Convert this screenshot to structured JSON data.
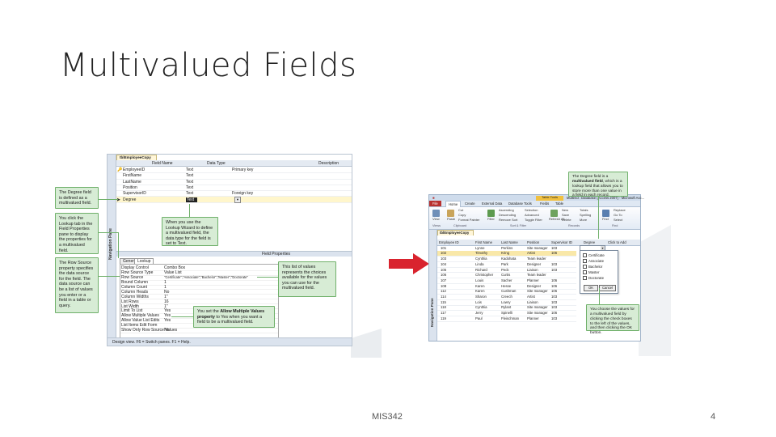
{
  "slide": {
    "title": "Multivalued Fields",
    "footer_course": "MIS342",
    "page_number": "4"
  },
  "left_screenshot": {
    "table_tab": "tblEmployeeCopy",
    "nav_pane_label": "Navigation Pane",
    "columns": {
      "field_name": "Field Name",
      "data_type": "Data Type",
      "description": "Description"
    },
    "fields": [
      {
        "name": "EmployeeID",
        "type": "Text",
        "description": "Primary key"
      },
      {
        "name": "FirstName",
        "type": "Text",
        "description": ""
      },
      {
        "name": "LastName",
        "type": "Text",
        "description": ""
      },
      {
        "name": "Position",
        "type": "Text",
        "description": ""
      },
      {
        "name": "SupervisorID",
        "type": "Text",
        "description": "Foreign key"
      },
      {
        "name": "Degree",
        "type": "Text",
        "description": ""
      }
    ],
    "field_properties_label": "Field Properties",
    "property_tabs": [
      "General",
      "Lookup"
    ],
    "lookup_properties": [
      {
        "name": "Display Control",
        "value": "Combo Box"
      },
      {
        "name": "Row Source Type",
        "value": "Value List"
      },
      {
        "name": "Row Source",
        "value": "\"Certificate\";\"Associate\";\"Bachelor\";\"Master\";\"Doctorate\""
      },
      {
        "name": "Bound Column",
        "value": "1"
      },
      {
        "name": "Column Count",
        "value": "1"
      },
      {
        "name": "Column Heads",
        "value": "No"
      },
      {
        "name": "Column Widths",
        "value": "1\""
      },
      {
        "name": "List Rows",
        "value": "16"
      },
      {
        "name": "List Width",
        "value": "1\""
      },
      {
        "name": "Limit To List",
        "value": "Yes"
      },
      {
        "name": "Allow Multiple Values",
        "value": "Yes"
      },
      {
        "name": "Allow Value List Edits",
        "value": "Yes"
      },
      {
        "name": "List Items Edit Form",
        "value": ""
      },
      {
        "name": "Show Only Row Source Values",
        "value": "No"
      }
    ],
    "status_bar": "Design view. F6 = Switch panes. F1 = Help."
  },
  "left_callouts": {
    "degree_field": "The Degree field is defined as a multivalued field.",
    "lookup_tab": "You click the Lookup tab in the Field Properties pane to display the properties for a multivalued field.",
    "row_source": "The Row Source property specifies the data source for the field. The data source can be a list of values you enter or a field in a table or query.",
    "lookup_wizard": "When you use the Lookup Wizard to define a multivalued field, the data type for the field is set to Text.",
    "value_list": "This list of values represents the choices available for the values you can use for the multivalued field.",
    "allow_multiple_pre": "You set the ",
    "allow_multiple_bold": "Allow Multiple Values property",
    "allow_multiple_post": " to Yes when you want a field to be a multivalued field."
  },
  "right_screenshot": {
    "window_title": "Mullend : Database (Access 2007) - Microsoft Acc...",
    "context_tab": "Table Tools",
    "ribbon_tabs": [
      "File",
      "Home",
      "Create",
      "External Data",
      "Database Tools",
      "Fields",
      "Table"
    ],
    "ribbon_items": {
      "view": "View",
      "paste": "Paste",
      "cut": "Cut",
      "copy": "Copy",
      "format_painter": "Format Painter",
      "filter": "Filter",
      "ascending": "Ascending",
      "descending": "Descending",
      "remove_sort": "Remove Sort",
      "selection": "Selection",
      "advanced": "Advanced",
      "toggle_filter": "Toggle Filter",
      "refresh": "Refresh All",
      "new": "New",
      "save": "Save",
      "delete": "Delete",
      "totals": "Totals",
      "spelling": "Spelling",
      "more": "More",
      "find": "Find",
      "replace": "Replace",
      "goto": "Go To",
      "select": "Select"
    },
    "ribbon_groups": [
      "Views",
      "Clipboard",
      "Sort & Filter",
      "Records",
      "Find"
    ],
    "nav_pane_label": "Navigation Pane",
    "table_tab": "tblEmployeeCopy",
    "columns": [
      "Employee ID",
      "First Name",
      "Last Name",
      "Position",
      "Supervisor ID",
      "Degree",
      "Click to Add"
    ],
    "rows": [
      [
        "101",
        "Lynne",
        "Perkins",
        "Site manager",
        "103"
      ],
      [
        "102",
        "Timothy",
        "Kring",
        "Artist",
        "106"
      ],
      [
        "103",
        "Cynthia",
        "Kadohata",
        "Team leader",
        ""
      ],
      [
        "104",
        "Linda",
        "Park",
        "Designer",
        "103"
      ],
      [
        "105",
        "Richard",
        "Peck",
        "Liaison",
        "103"
      ],
      [
        "106",
        "Christopher",
        "Curtis",
        "Team leader",
        ""
      ],
      [
        "107",
        "Louis",
        "Sacher",
        "Planner",
        "106"
      ],
      [
        "108",
        "Karen",
        "Hesse",
        "Designer",
        "106"
      ],
      [
        "112",
        "Karen",
        "Cushman",
        "Site manager",
        "106"
      ],
      [
        "114",
        "Sharon",
        "Creech",
        "Artist",
        "103"
      ],
      [
        "115",
        "Lois",
        "Lowry",
        "Liaison",
        "103"
      ],
      [
        "118",
        "Cynthia",
        "Rylant",
        "Site manager",
        "103"
      ],
      [
        "117",
        "Jerry",
        "Spinelli",
        "Site manager",
        "106"
      ],
      [
        "119",
        "Paul",
        "Fleischman",
        "Planner",
        "103"
      ]
    ],
    "degree_options": [
      "Certificate",
      "Associate",
      "Bachelor",
      "Master",
      "Doctorate"
    ],
    "ok_label": "OK",
    "cancel_label": "Cancel"
  },
  "right_callouts": {
    "degree_top_pre": "The Degree field is a ",
    "degree_top_bold": "multivalued field",
    "degree_top_post": ", which is a lookup field that allows you to store more than one value in a field in each record.",
    "choose_values": "You choose the values for a multivalued field by clicking the check boxes to the left of the values, and then clicking the OK button."
  },
  "colors": {
    "callout_fill": "#d7ecd5",
    "callout_border": "#6fb06a",
    "arrow_red": "#d9232e",
    "access_file_tab": "#b8312f"
  }
}
